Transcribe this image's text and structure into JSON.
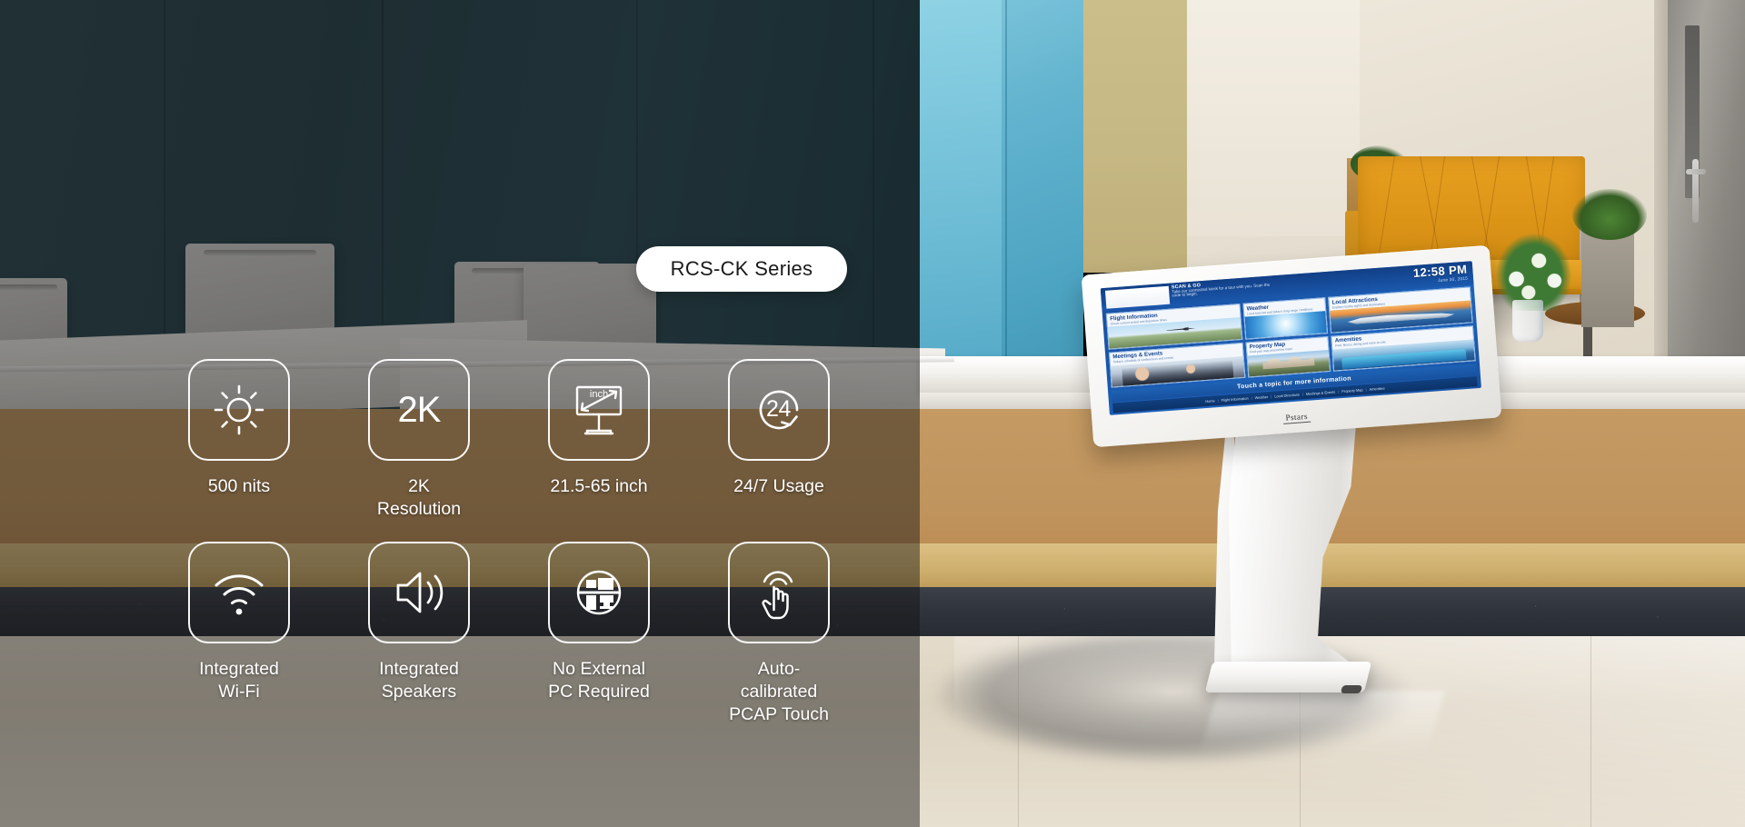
{
  "badge": {
    "label": "RCS-CK Series"
  },
  "features": {
    "row1": [
      {
        "icon": "brightness-sun-icon",
        "label": "500 nits"
      },
      {
        "icon": "2k-resolution-icon",
        "label": "2K Resolution",
        "glyph": "2K"
      },
      {
        "icon": "display-size-inch-icon",
        "label": "21.5-65 inch",
        "inner_text": "inch"
      },
      {
        "icon": "24-7-cycle-icon",
        "label": "24/7 Usage",
        "glyph": "24"
      }
    ],
    "row2": [
      {
        "icon": "wifi-icon",
        "label": "Integrated\nWi-Fi"
      },
      {
        "icon": "speaker-icon",
        "label": "Integrated\nSpeakers"
      },
      {
        "icon": "no-external-pc-icon",
        "label": "No External\nPC Required"
      },
      {
        "icon": "touch-hand-icon",
        "label": "Auto-calibrated\nPCAP Touch"
      }
    ]
  },
  "kiosk_screen": {
    "brand_title": "SCAN & GO",
    "brand_sub": "Take our connected kiosk\nfor a tour with you.\nScan the code to begin.",
    "time": "12:58 PM",
    "date": "June 30, 2015",
    "cards": [
      {
        "title": "Flight Information",
        "desc": "Check current arrival and departure times"
      },
      {
        "title": "Weather",
        "desc": "Local forecast and today's long range conditions"
      },
      {
        "title": "Local Attractions",
        "desc": "Explore nearby sights and destinations"
      },
      {
        "title": "Meetings & Events",
        "desc": "Today's schedule of conferences and events"
      },
      {
        "title": "Property Map",
        "desc": "Find your way around the hotel"
      },
      {
        "title": "Amenities",
        "desc": "Pool, fitness, dining and more on site"
      }
    ],
    "cta": "Touch a topic for more information",
    "nav": [
      "Home",
      "Flight Information",
      "Weather",
      "Local Directions",
      "Meetings & Events",
      "Property Map",
      "Amenities"
    ],
    "nav_separator": "|",
    "logo": "Pstars"
  },
  "colors": {
    "badge_bg": "#ffffff",
    "badge_text": "#1a1a1a",
    "icon_stroke": "#ffffff",
    "wall_teal": "#27444d",
    "wall_teal_bright": "#63b4cf",
    "wall_gold": "#c6b884",
    "bench_gold": "#dc9417",
    "kiosk_blue": "#1a56ab",
    "overlay": "rgba(18,18,18,0.45)"
  }
}
